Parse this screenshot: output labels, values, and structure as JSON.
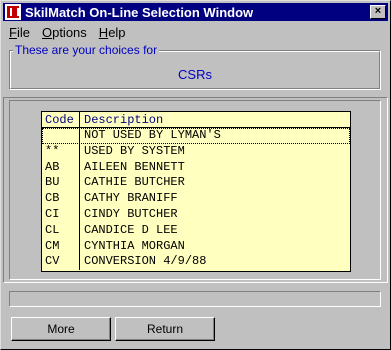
{
  "window": {
    "title": "SkilMatch On-Line Selection Window",
    "close_glyph": "×"
  },
  "menu": [
    {
      "label": "File",
      "accel": "F",
      "rest": "ile"
    },
    {
      "label": "Options",
      "accel": "O",
      "rest": "ptions"
    },
    {
      "label": "Help",
      "accel": "H",
      "rest": "elp"
    }
  ],
  "choices": {
    "legend": "These are your choices for",
    "value": "CSRs"
  },
  "grid": {
    "headers": {
      "code": "Code",
      "description": "Description"
    },
    "rows": [
      {
        "code": "",
        "description": "NOT USED BY LYMAN'S"
      },
      {
        "code": "**",
        "description": "USED BY SYSTEM"
      },
      {
        "code": "AB",
        "description": "AILEEN BENNETT"
      },
      {
        "code": "BU",
        "description": "CATHIE BUTCHER"
      },
      {
        "code": "CB",
        "description": "CATHY BRANIFF"
      },
      {
        "code": "CI",
        "description": "CINDY BUTCHER"
      },
      {
        "code": "CL",
        "description": "CANDICE D LEE"
      },
      {
        "code": "CM",
        "description": "CYNTHIA MORGAN"
      },
      {
        "code": "CV",
        "description": "CONVERSION 4/9/88"
      }
    ],
    "selected_index": 0
  },
  "buttons": {
    "more": "More",
    "return": "Return"
  }
}
